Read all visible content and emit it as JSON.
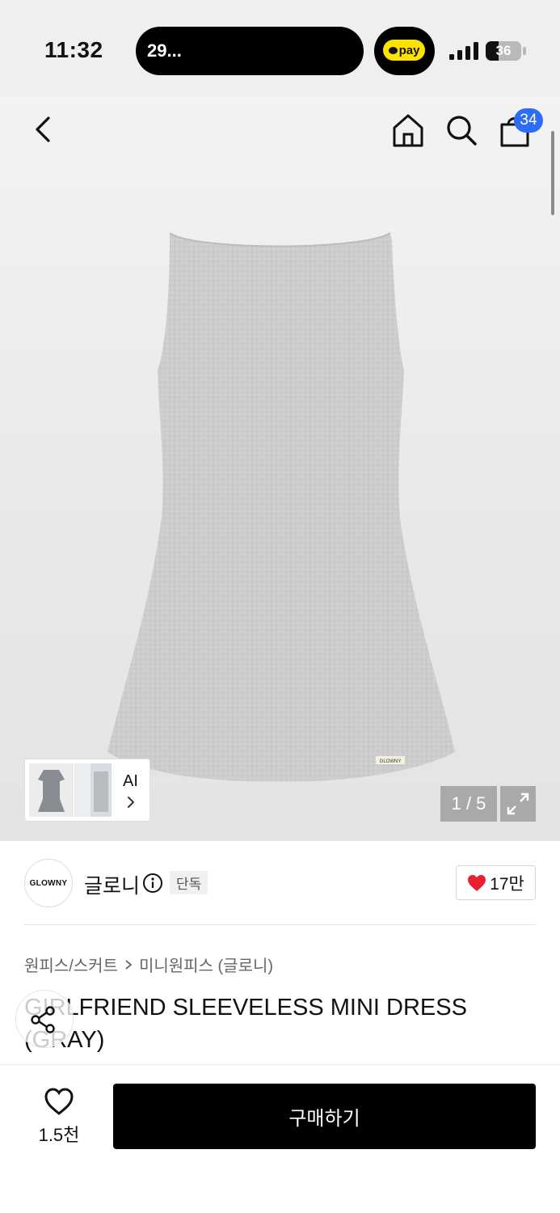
{
  "status_bar": {
    "time": "11:32",
    "live_activity": "29...",
    "pay_label": "pay",
    "battery_level": "36",
    "battery_fraction": 0.36
  },
  "nav": {
    "back_icon": "chevron-left-icon",
    "home_icon": "home-icon",
    "search_icon": "search-icon",
    "cart_icon": "shopping-bag-icon",
    "cart_count": "34"
  },
  "gallery": {
    "ai_label": "AI",
    "counter": "1 / 5",
    "label_on_dress": "GLOWNY"
  },
  "brand": {
    "logo_text": "GLOWNY",
    "name": "글로니",
    "exclusive_badge": "단독",
    "like_count": "17만"
  },
  "product": {
    "breadcrumb": [
      "원피스/스커트",
      "미니원피스 (글로니)"
    ],
    "title": "GIRLFRIEND SLEEVELESS MINI DRESS (GRAY)"
  },
  "bottom": {
    "wish_count": "1.5천",
    "buy_label": "구매하기"
  },
  "colors": {
    "badge_blue": "#2d6cf5",
    "heart_red": "#e8202f",
    "pay_yellow": "#ffe300",
    "buy_black": "#000000"
  }
}
